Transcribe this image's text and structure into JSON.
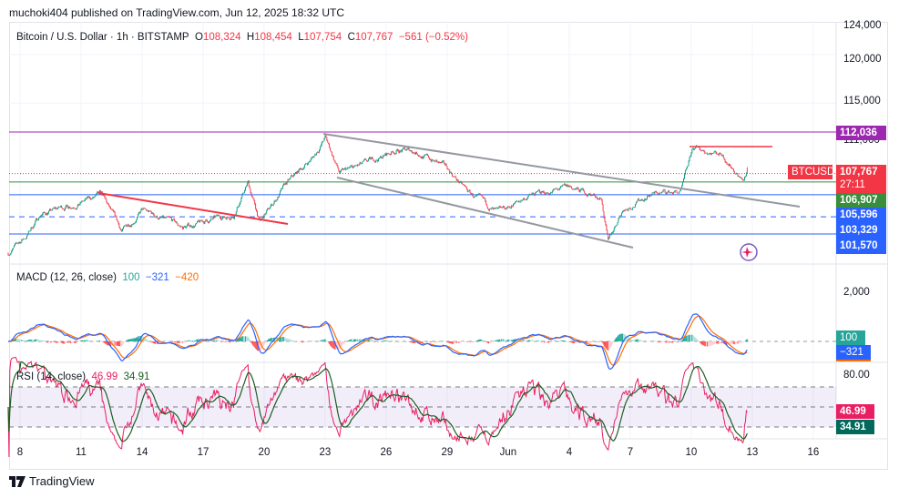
{
  "header": {
    "published": "muchoki404 published on TradingView.com, Jun 12, 2025 18:32 UTC"
  },
  "legend": {
    "symbol": "Bitcoin / U.S. Dollar · 1h · BITSTAMP",
    "o_label": "O",
    "o": "108,324",
    "h_label": "H",
    "h": "108,454",
    "l_label": "L",
    "l": "107,754",
    "c_label": "C",
    "c": "107,767",
    "change": "−561 (−0.52%)"
  },
  "macd_legend": {
    "title": "MACD (12, 26, close)",
    "hist": "100",
    "macd": "−321",
    "signal": "−420"
  },
  "rsi_legend": {
    "title": "RSI (14, close)",
    "rsi": "46.99",
    "ma": "34.91"
  },
  "price_axis": {
    "ticks": [
      "124,000",
      "120,000",
      "115,000",
      "111,000"
    ],
    "tick_values": [
      124000,
      120000,
      115000,
      111000
    ]
  },
  "price_labels": {
    "resistance": "112,036",
    "symbol_tag": "BTCUSD",
    "last": "107,767",
    "countdown": "27:11",
    "green_level": "106,907",
    "blue1": "105,596",
    "blue2": "103,329",
    "blue3": "101,570"
  },
  "macd_axis": {
    "tick": "2,000",
    "hist_label": "100",
    "macd_label": "−321"
  },
  "rsi_axis": {
    "tick": "80.00",
    "rsi_label": "46.99",
    "ma_label": "34.91"
  },
  "time_axis": {
    "ticks": [
      "8",
      "11",
      "14",
      "17",
      "20",
      "23",
      "26",
      "29",
      "Jun",
      "4",
      "7",
      "10",
      "13",
      "16"
    ]
  },
  "footer": {
    "brand": "TradingView"
  },
  "colors": {
    "up": "#089981",
    "down": "#f23645",
    "macd": "#2962ff",
    "signal": "#ff6d00",
    "rsi": "#e91e63",
    "rsi_ma": "#1b5e20",
    "resistance": "#9c27b0",
    "support_green": "#388e3c",
    "support_blue": "#2962ff"
  },
  "chart_data": {
    "type": "candlestick",
    "symbol": "BTCUSD",
    "interval": "1h",
    "exchange": "BITSTAMP",
    "x_range": [
      "2025-05-07",
      "2025-06-17"
    ],
    "y_range": [
      99000,
      125000
    ],
    "close_path": [
      [
        "2025-05-07 10:00",
        99600
      ],
      [
        "2025-05-08 07:00",
        101300
      ],
      [
        "2025-05-09 00:00",
        103600
      ],
      [
        "2025-05-12 00:00",
        105500
      ],
      [
        "2025-05-13 00:00",
        101800
      ],
      [
        "2025-05-14 00:00",
        104000
      ],
      [
        "2025-05-16 00:00",
        102200
      ],
      [
        "2025-05-18 12:00",
        103600
      ],
      [
        "2025-05-19 05:00",
        106800
      ],
      [
        "2025-05-19 19:00",
        102700
      ],
      [
        "2025-05-21 00:00",
        106400
      ],
      [
        "2025-05-22 12:00",
        109700
      ],
      [
        "2025-05-23 00:00",
        111500
      ],
      [
        "2025-05-23 17:00",
        107800
      ],
      [
        "2025-05-25 00:00",
        108700
      ],
      [
        "2025-05-26 12:00",
        110200
      ],
      [
        "2025-05-27 12:00",
        110000
      ],
      [
        "2025-05-29 00:00",
        108300
      ],
      [
        "2025-05-30 00:00",
        105900
      ],
      [
        "2025-05-31 12:00",
        103600
      ],
      [
        "2025-06-02 00:00",
        105500
      ],
      [
        "2025-06-04 00:00",
        106300
      ],
      [
        "2025-06-05 14:00",
        105300
      ],
      [
        "2025-06-05 22:00",
        100600
      ],
      [
        "2025-06-06 14:00",
        104000
      ],
      [
        "2025-06-08 00:00",
        105700
      ],
      [
        "2025-06-09 12:00",
        105900
      ],
      [
        "2025-06-10 02:00",
        110300
      ],
      [
        "2025-06-11 12:00",
        109900
      ],
      [
        "2025-06-12 10:00",
        107400
      ],
      [
        "2025-06-12 14:00",
        107100
      ],
      [
        "2025-06-12 18:00",
        107767
      ]
    ],
    "last": {
      "open": 108324,
      "high": 108454,
      "low": 107754,
      "close": 107767,
      "change": -561,
      "change_pct": -0.52
    },
    "levels": {
      "resistance": 112036,
      "last": 107767,
      "green": 106907,
      "blue_solid_upper": 105596,
      "blue_dashed": 103329,
      "blue_solid_lower": 101570
    },
    "indicators": {
      "macd": {
        "params": [
          12,
          26
        ],
        "hist": 100,
        "macd": -321,
        "signal": -420,
        "tick": 2000
      },
      "rsi": {
        "period": 14,
        "value": 46.99,
        "ma": 34.91,
        "bands": [
          70,
          50,
          30
        ],
        "tick": 80
      }
    }
  }
}
